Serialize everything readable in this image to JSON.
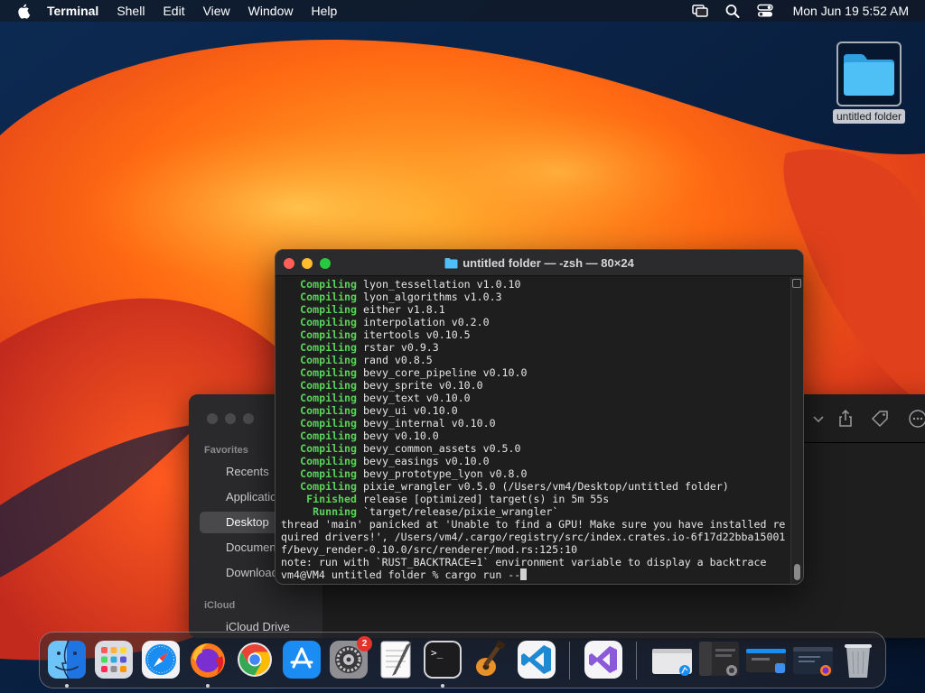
{
  "menubar": {
    "app_name": "Terminal",
    "menus": [
      "Shell",
      "Edit",
      "View",
      "Window",
      "Help"
    ],
    "clock": "Mon Jun 19  5:52 AM",
    "tray_icons": [
      "screen-mirror-icon",
      "search-icon",
      "control-center-icon"
    ]
  },
  "desktop": {
    "folder_label": "untitled folder"
  },
  "finder": {
    "sidebar": {
      "favorites_header": "Favorites",
      "items": [
        "Recents",
        "Applications",
        "Desktop",
        "Documents",
        "Downloads"
      ],
      "selected": "Desktop",
      "icloud_header": "iCloud",
      "icloud_items": [
        "iCloud Drive"
      ]
    }
  },
  "terminal": {
    "title": "untitled folder — -zsh — 80×24",
    "lines": [
      {
        "kw": "Compiling",
        "text": "lyon_tessellation v1.0.10"
      },
      {
        "kw": "Compiling",
        "text": "lyon_algorithms v1.0.3"
      },
      {
        "kw": "Compiling",
        "text": "either v1.8.1"
      },
      {
        "kw": "Compiling",
        "text": "interpolation v0.2.0"
      },
      {
        "kw": "Compiling",
        "text": "itertools v0.10.5"
      },
      {
        "kw": "Compiling",
        "text": "rstar v0.9.3"
      },
      {
        "kw": "Compiling",
        "text": "rand v0.8.5"
      },
      {
        "kw": "Compiling",
        "text": "bevy_core_pipeline v0.10.0"
      },
      {
        "kw": "Compiling",
        "text": "bevy_sprite v0.10.0"
      },
      {
        "kw": "Compiling",
        "text": "bevy_text v0.10.0"
      },
      {
        "kw": "Compiling",
        "text": "bevy_ui v0.10.0"
      },
      {
        "kw": "Compiling",
        "text": "bevy_internal v0.10.0"
      },
      {
        "kw": "Compiling",
        "text": "bevy v0.10.0"
      },
      {
        "kw": "Compiling",
        "text": "bevy_common_assets v0.5.0"
      },
      {
        "kw": "Compiling",
        "text": "bevy_easings v0.10.0"
      },
      {
        "kw": "Compiling",
        "text": "bevy_prototype_lyon v0.8.0"
      },
      {
        "kw": "Compiling",
        "text": "pixie_wrangler v0.5.0 (/Users/vm4/Desktop/untitled folder)"
      },
      {
        "kw": "Finished",
        "text": "release [optimized] target(s) in 5m 55s"
      },
      {
        "kw": "Running",
        "text": "`target/release/pixie_wrangler`"
      },
      {
        "kw": "",
        "text": "thread 'main' panicked at 'Unable to find a GPU! Make sure you have installed re"
      },
      {
        "kw": "",
        "text": "quired drivers!', /Users/vm4/.cargo/registry/src/index.crates.io-6f17d22bba15001"
      },
      {
        "kw": "",
        "text": "f/bevy_render-0.10.0/src/renderer/mod.rs:125:10"
      },
      {
        "kw": "",
        "text": "note: run with `RUST_BACKTRACE=1` environment variable to display a backtrace"
      }
    ],
    "prompt": "vm4@VM4 untitled folder % cargo run --"
  },
  "dock": {
    "apps": [
      {
        "name": "finder",
        "running": true
      },
      {
        "name": "launchpad",
        "running": false
      },
      {
        "name": "safari",
        "running": false
      },
      {
        "name": "firefox",
        "running": true
      },
      {
        "name": "chrome",
        "running": false
      },
      {
        "name": "app-store",
        "running": false
      },
      {
        "name": "system-settings",
        "running": false,
        "badge": "2"
      },
      {
        "name": "textedit",
        "running": false
      },
      {
        "name": "terminal",
        "running": true
      },
      {
        "name": "garageband",
        "running": false
      },
      {
        "name": "vscode",
        "running": false
      },
      {
        "name": "visual-studio",
        "running": false
      }
    ],
    "terminal_icon_text": ">_"
  },
  "colors": {
    "keyword_green": "#5ad35a",
    "traffic_red": "#ff5f57",
    "traffic_yellow": "#febc2e",
    "traffic_green": "#28c840",
    "folder_blue": "#3fb3ef"
  }
}
